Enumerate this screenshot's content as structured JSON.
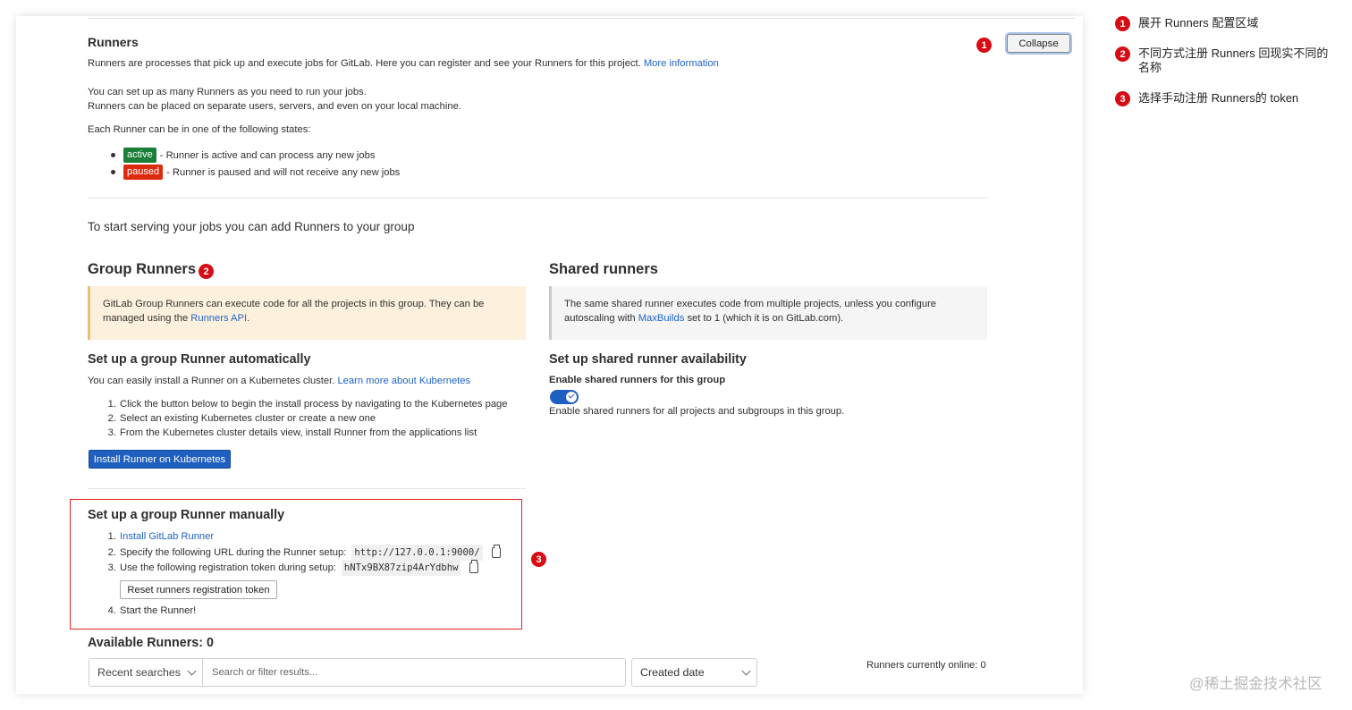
{
  "runners_section": {
    "title": "Runners",
    "collapse_label": "Collapse",
    "intro": "Runners are processes that pick up and execute jobs for GitLab. Here you can register and see your Runners for this project.",
    "more_info_link": "More information",
    "setup_line1": "You can set up as many Runners as you need to run your jobs.",
    "setup_line2": "Runners can be placed on separate users, servers, and even on your local machine.",
    "states_intro": "Each Runner can be in one of the following states:",
    "states": [
      {
        "badge": "active",
        "text": "- Runner is active and can process any new jobs"
      },
      {
        "badge": "paused",
        "text": "- Runner is paused and will not receive any new jobs"
      }
    ],
    "colors": {
      "active": "#1a7f37",
      "paused": "#dd2b0e",
      "primary": "#1f5fbf"
    }
  },
  "start_text": "To start serving your jobs you can add Runners to your group",
  "group_runners": {
    "title": "Group Runners",
    "callout_text": "GitLab Group Runners can execute code for all the projects in this group. They can be managed using the",
    "callout_link": "Runners API",
    "callout_end": ".",
    "auto": {
      "title": "Set up a group Runner automatically",
      "desc": "You can easily install a Runner on a Kubernetes cluster.",
      "desc_link": "Learn more about Kubernetes",
      "steps": [
        "Click the button below to begin the install process by navigating to the Kubernetes page",
        "Select an existing Kubernetes cluster or create a new one",
        "From the Kubernetes cluster details view, install Runner from the applications list"
      ],
      "button": "Install Runner on Kubernetes"
    },
    "manual": {
      "title": "Set up a group Runner manually",
      "step1_link": "Install GitLab Runner",
      "step2_text": "Specify the following URL during the Runner setup:",
      "url": "http://127.0.0.1:9000/",
      "step3_text": "Use the following registration token during setup:",
      "token": "hNTx9BX87zip4ArYdbhw",
      "reset_button": "Reset runners registration token",
      "step4_text": "Start the Runner!"
    }
  },
  "shared_runners": {
    "title": "Shared runners",
    "callout_pre": "The same shared runner executes code from multiple projects, unless you configure autoscaling with",
    "callout_link": "MaxBuilds",
    "callout_post": "set to 1 (which it is on GitLab.com).",
    "availability_title": "Set up shared runner availability",
    "enable_label": "Enable shared runners for this group",
    "enable_help": "Enable shared runners for all projects and subgroups in this group."
  },
  "available": {
    "title": "Available Runners: 0",
    "recent_searches": "Recent searches",
    "search_placeholder": "Search or filter results...",
    "sort_label": "Created date",
    "online_text": "Runners currently online: 0"
  },
  "annotations": [
    {
      "num": "1",
      "text": "展开 Runners 配置区域"
    },
    {
      "num": "2",
      "text": "不同方式注册 Runners 回现实不同的名称"
    },
    {
      "num": "3",
      "text": "选择手动注册 Runners的 token"
    }
  ],
  "watermark": "@稀土掘金技术社区"
}
